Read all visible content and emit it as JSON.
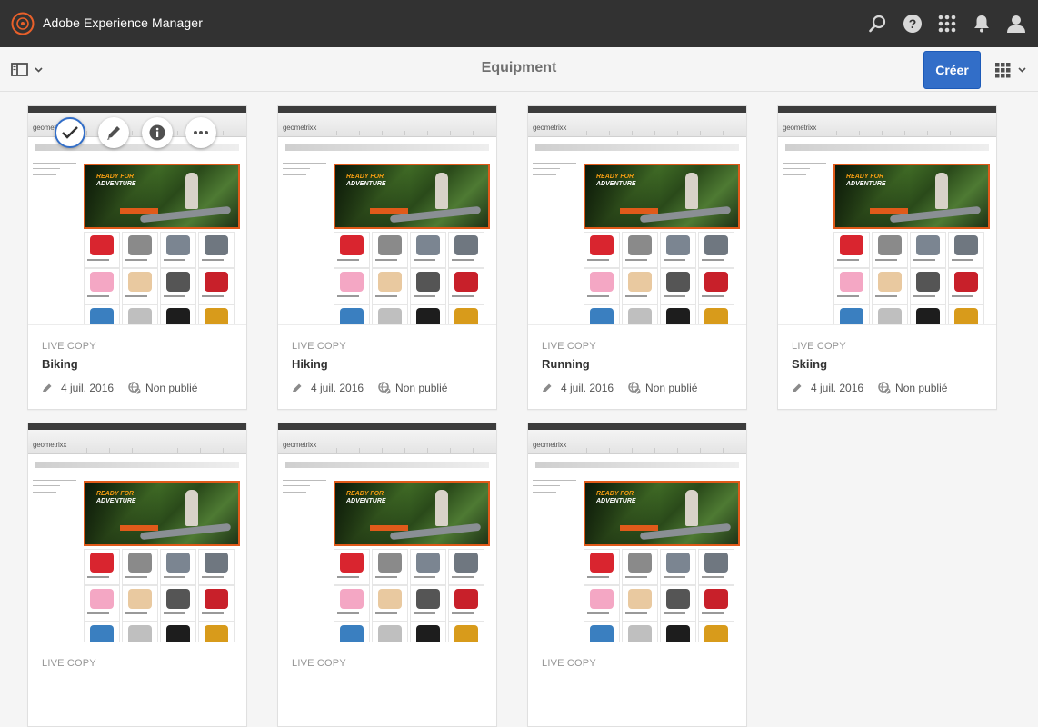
{
  "app": {
    "title": "Adobe Experience Manager"
  },
  "header": {
    "page_title": "Equipment",
    "create_label": "Créer"
  },
  "colors": {
    "topbar": "#323232",
    "accent": "#326ec8",
    "hero_border": "#e05a1a"
  },
  "icons": {
    "top": [
      "search-icon",
      "help-icon",
      "apps-icon",
      "notification-bell-icon",
      "user-icon"
    ],
    "card_actions": [
      "check-icon",
      "pencil-icon",
      "info-icon",
      "more-icon"
    ],
    "meta": [
      "pencil-icon",
      "globe-unpublished-icon"
    ]
  },
  "thumbnail": {
    "logo_text": "geometrixx",
    "hero_line1": "READY FOR",
    "hero_line2": "ADVENTURE"
  },
  "cards": [
    {
      "type": "LIVE COPY",
      "title": "Biking",
      "date": "4 juil. 2016",
      "status": "Non publié",
      "selected": true
    },
    {
      "type": "LIVE COPY",
      "title": "Hiking",
      "date": "4 juil. 2016",
      "status": "Non publié"
    },
    {
      "type": "LIVE COPY",
      "title": "Running",
      "date": "4 juil. 2016",
      "status": "Non publié"
    },
    {
      "type": "LIVE COPY",
      "title": "Skiing",
      "date": "4 juil. 2016",
      "status": "Non publié"
    },
    {
      "type": "LIVE COPY",
      "title": "",
      "date": "",
      "status": ""
    },
    {
      "type": "LIVE COPY",
      "title": "",
      "date": "",
      "status": ""
    },
    {
      "type": "LIVE COPY",
      "title": "",
      "date": "",
      "status": ""
    }
  ]
}
